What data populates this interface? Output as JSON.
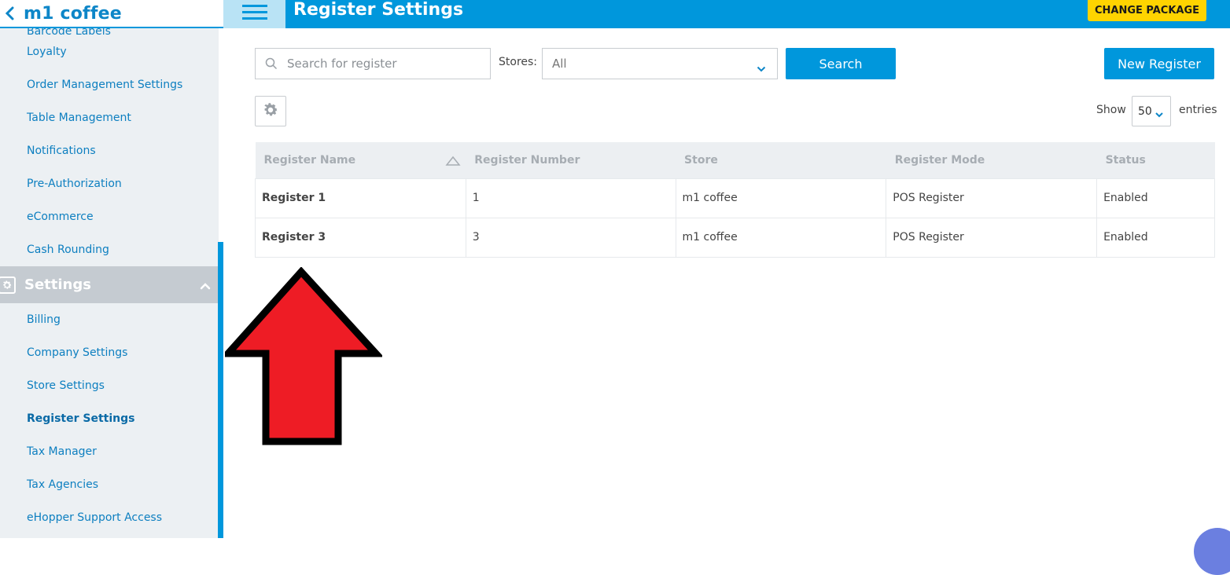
{
  "sidebar": {
    "company_name": "m1 coffee",
    "items_above": [
      {
        "label": "Barcode Labels"
      },
      {
        "label": "Loyalty"
      },
      {
        "label": "Order Management Settings"
      },
      {
        "label": "Table Management"
      },
      {
        "label": "Notifications"
      },
      {
        "label": "Pre-Authorization"
      },
      {
        "label": "eCommerce"
      },
      {
        "label": "Cash Rounding"
      }
    ],
    "section": {
      "label": "Settings",
      "icon": "gear-icon",
      "expanded": true
    },
    "items_below": [
      {
        "label": "Billing"
      },
      {
        "label": "Company Settings"
      },
      {
        "label": "Store Settings"
      },
      {
        "label": "Register Settings",
        "active": true
      },
      {
        "label": "Tax Manager"
      },
      {
        "label": "Tax Agencies"
      },
      {
        "label": "eHopper Support Access"
      }
    ]
  },
  "header": {
    "title": "Register Settings",
    "change_package_label": "CHANGE PACKAGE",
    "menu_icon": "hamburger-icon"
  },
  "toolbar": {
    "search_placeholder": "Search for register",
    "stores_label": "Stores:",
    "stores_value": "All",
    "search_button": "Search",
    "new_register_button": "New Register",
    "show_label": "Show",
    "entries_value": "50",
    "entries_label": "entries"
  },
  "table": {
    "columns": [
      "Register Name",
      "Register Number",
      "Store",
      "Register Mode",
      "Status"
    ],
    "rows": [
      [
        "Register 1",
        "1",
        "m1 coffee",
        "POS Register",
        "Enabled"
      ],
      [
        "Register 3",
        "3",
        "m1 coffee",
        "POS Register",
        "Enabled"
      ]
    ]
  },
  "colors": {
    "primary": "#0097dc",
    "accent_yellow": "#ffd400",
    "sidebar_bg": "#ecf0f3",
    "annotation_arrow": "#ee1c25"
  }
}
